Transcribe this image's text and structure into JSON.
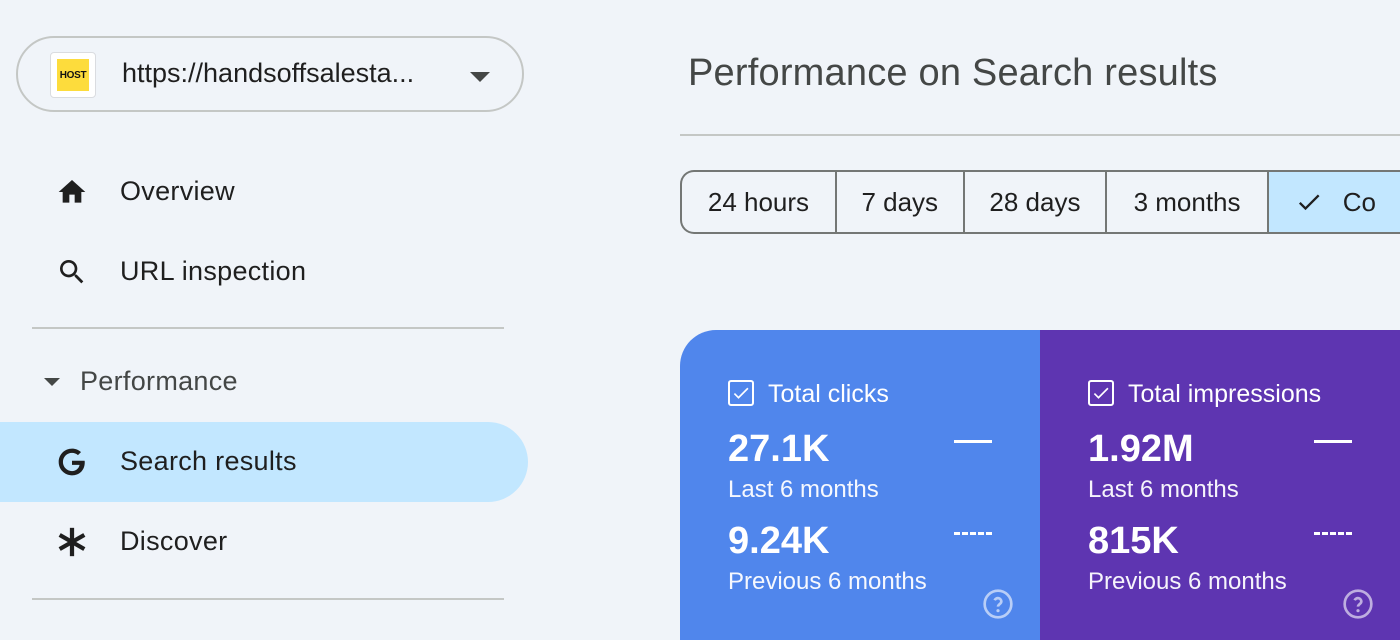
{
  "property": {
    "favicon_text": "HOST",
    "url": "https://handsoffsalesta..."
  },
  "sidebar": {
    "items": [
      {
        "label": "Overview",
        "icon": "home-icon"
      },
      {
        "label": "URL inspection",
        "icon": "search-icon"
      }
    ],
    "section": {
      "label": "Performance"
    },
    "section_items": [
      {
        "label": "Search results",
        "icon": "google-g-icon",
        "active": true
      },
      {
        "label": "Discover",
        "icon": "discover-asterisk-icon"
      }
    ]
  },
  "main": {
    "title": "Performance on Search results",
    "date_ranges": [
      {
        "label": "24 hours"
      },
      {
        "label": "7 days"
      },
      {
        "label": "28 days"
      },
      {
        "label": "3 months"
      },
      {
        "label": "Co",
        "selected": true
      }
    ],
    "metrics": {
      "clicks": {
        "label": "Total clicks",
        "current_value": "27.1K",
        "current_period": "Last 6 months",
        "previous_value": "9.24K",
        "previous_period": "Previous 6 months",
        "color": "#5086ec"
      },
      "impressions": {
        "label": "Total impressions",
        "current_value": "1.92M",
        "current_period": "Last 6 months",
        "previous_value": "815K",
        "previous_period": "Previous 6 months",
        "color": "#5e35b1"
      }
    }
  },
  "colors": {
    "background": "#f0f4f9",
    "active_nav": "#c2e7ff",
    "favicon_bg": "#fddc3c"
  }
}
